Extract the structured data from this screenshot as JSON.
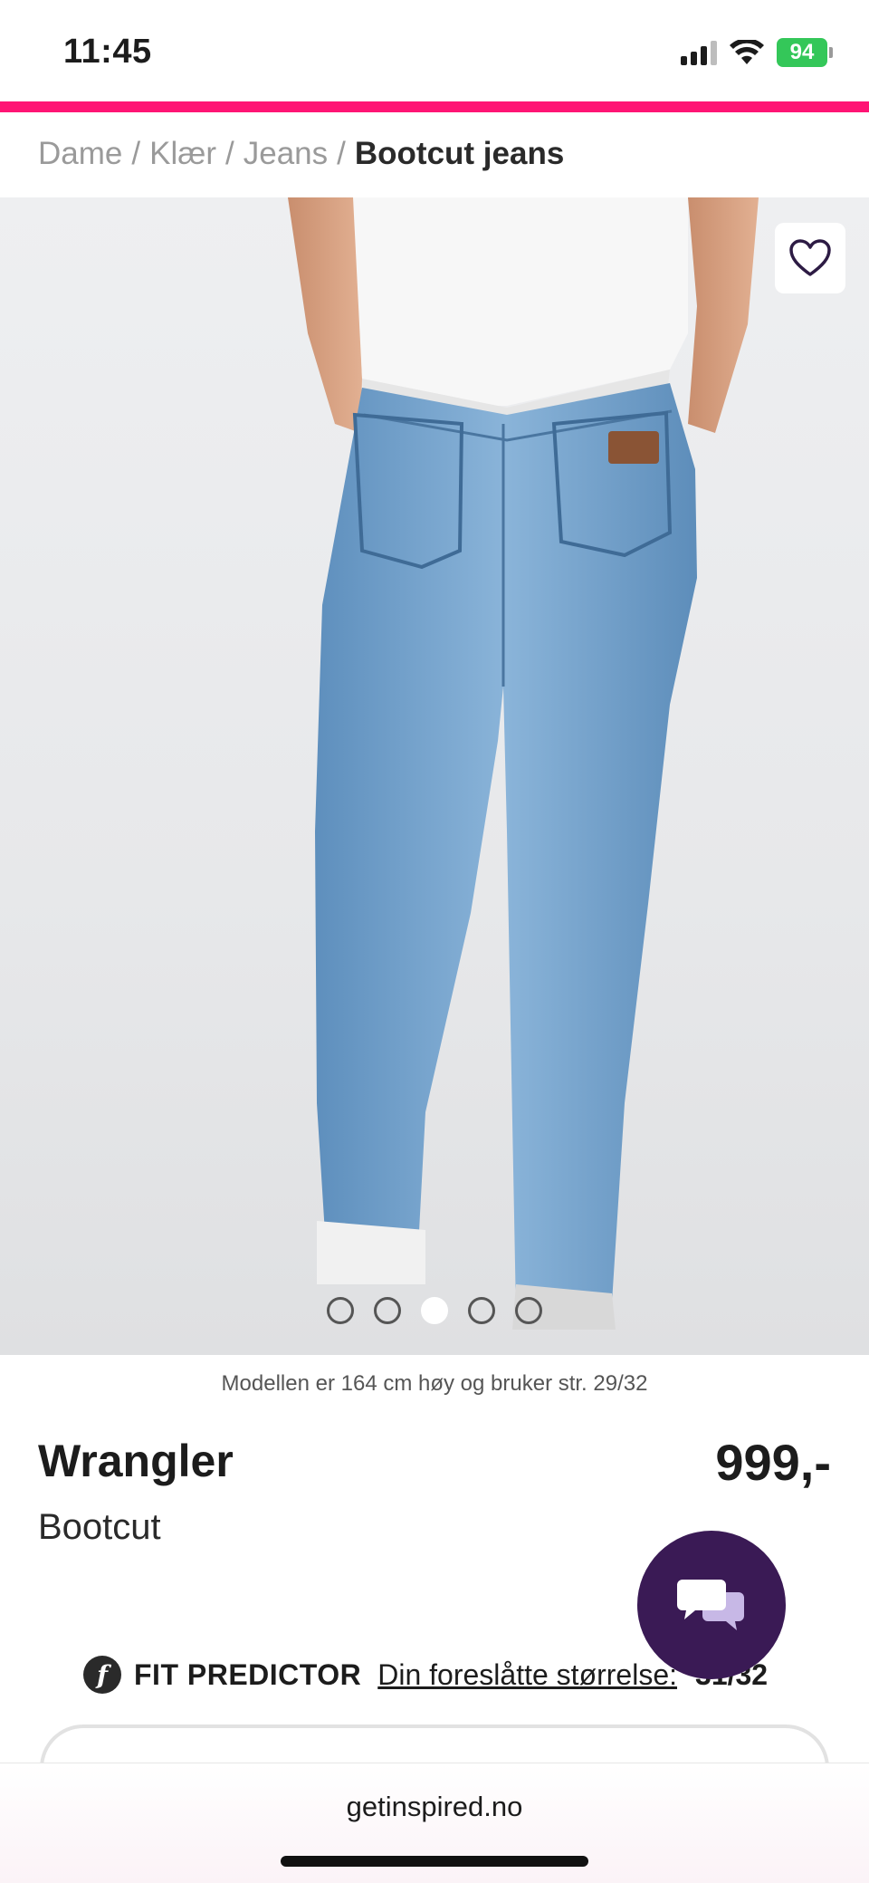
{
  "status_bar": {
    "time": "11:45",
    "battery": "94",
    "icons": [
      "signal-icon",
      "wifi-icon",
      "battery-charging-icon"
    ]
  },
  "colors": {
    "accent": "#ff1474",
    "chat_button": "#3a1a55",
    "battery": "#34c759"
  },
  "breadcrumb": {
    "items": [
      "Dame",
      "Klær",
      "Jeans"
    ],
    "separator": "/",
    "current": "Bootcut jeans"
  },
  "gallery": {
    "slides": 5,
    "active_index": 2,
    "favorite_icon": "heart-outline-icon"
  },
  "product": {
    "model_info": "Modellen er 164 cm høy og bruker str. 29/32",
    "brand": "Wrangler",
    "price": "999,-",
    "name": "Bootcut"
  },
  "fit_predictor": {
    "logo_letter": "f",
    "label": "FIT PREDICTOR",
    "suggestion_label": "Din foreslåtte størrelse:",
    "size": "31/32"
  },
  "chat": {
    "icon": "chat-bubbles-icon"
  },
  "browser": {
    "url": "getinspired.no"
  }
}
